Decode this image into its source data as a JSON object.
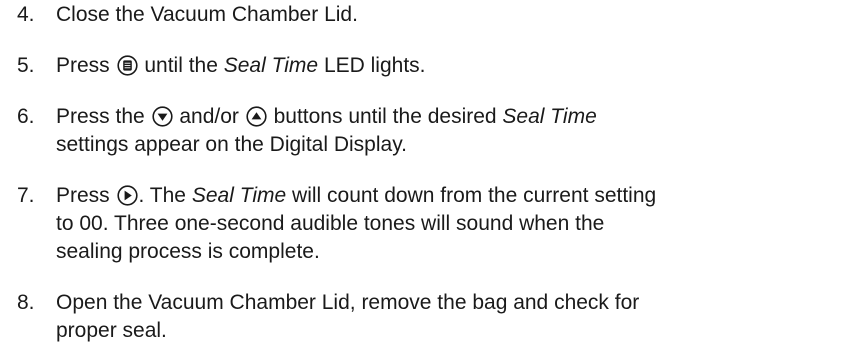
{
  "steps": [
    {
      "number": "4.",
      "text": "Close the Vacuum Chamber Lid."
    },
    {
      "number": "5.",
      "before_icon": "Press ",
      "icon": "menu-select-button-icon",
      "after_icon": " until the ",
      "emphasis": "Seal Time",
      "end": " LED lights."
    },
    {
      "number": "6.",
      "line1_start": "Press the ",
      "icon_down": "down-arrow-button-icon",
      "line1_mid": " and/or ",
      "icon_up": "up-arrow-button-icon",
      "line1_after": " buttons until the desired ",
      "emphasis": "Seal Time",
      "line2": "settings appear on the Digital Display."
    },
    {
      "number": "7.",
      "line1_start": "Press ",
      "icon": "start-play-button-icon",
      "line1_after": ". The ",
      "emphasis": "Seal Time",
      "line1_end": " will count down from the current setting",
      "line2": "to 00. Three one-second audible tones will sound when the",
      "line3": "sealing process is complete."
    },
    {
      "number": "8.",
      "line1": "Open the Vacuum Chamber Lid, remove the bag and check for",
      "line2": "proper seal."
    }
  ]
}
